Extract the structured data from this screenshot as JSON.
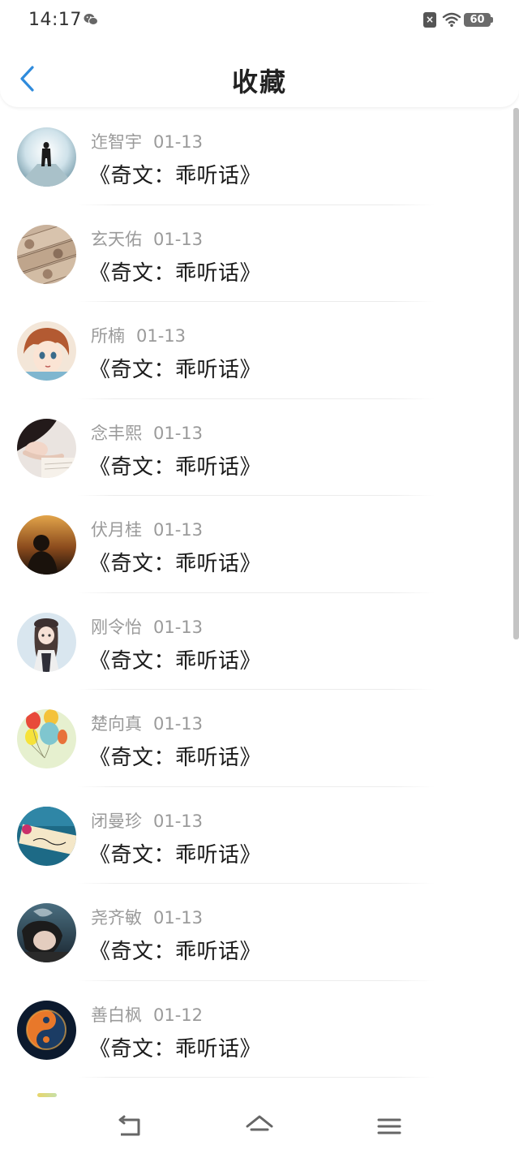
{
  "status_bar": {
    "time": "14:17",
    "battery": "60",
    "sim_icon": "sim-off-icon",
    "wifi_icon": "wifi-icon",
    "app_icon": "wechat-icon"
  },
  "header": {
    "title": "收藏",
    "back_icon": "chevron-left-icon"
  },
  "colors": {
    "accent": "#2f8bdc",
    "title_text": "#1a1a1a",
    "meta_text": "#9a9a9a"
  },
  "favorites": [
    {
      "author": "迮智宇",
      "date": "01-13",
      "title": "《奇文：乖听话》",
      "avatar": "silhouette-tunnel-avatar"
    },
    {
      "author": "玄天佑",
      "date": "01-13",
      "title": "《奇文：乖听话》",
      "avatar": "banknotes-avatar"
    },
    {
      "author": "所楠",
      "date": "01-13",
      "title": "《奇文：乖听话》",
      "avatar": "anime-girl-avatar"
    },
    {
      "author": "念丰熙",
      "date": "01-13",
      "title": "《奇文：乖听话》",
      "avatar": "sleeping-girl-avatar"
    },
    {
      "author": "伏月桂",
      "date": "01-13",
      "title": "《奇文：乖听话》",
      "avatar": "sunset-silhouette-avatar"
    },
    {
      "author": "刚令怡",
      "date": "01-13",
      "title": "《奇文：乖听话》",
      "avatar": "cartoon-girl-avatar"
    },
    {
      "author": "楚向真",
      "date": "01-13",
      "title": "《奇文：乖听话》",
      "avatar": "balloons-avatar"
    },
    {
      "author": "闭曼珍",
      "date": "01-13",
      "title": "《奇文：乖听话》",
      "avatar": "love-note-avatar"
    },
    {
      "author": "尧齐敏",
      "date": "01-13",
      "title": "《奇文：乖听话》",
      "avatar": "smoking-boy-avatar"
    },
    {
      "author": "善白枫",
      "date": "01-12",
      "title": "《奇文：乖听话》",
      "avatar": "yin-yang-fire-avatar"
    }
  ],
  "nav": {
    "back_icon": "nav-back-icon",
    "home_icon": "nav-home-icon",
    "menu_icon": "nav-menu-icon"
  }
}
